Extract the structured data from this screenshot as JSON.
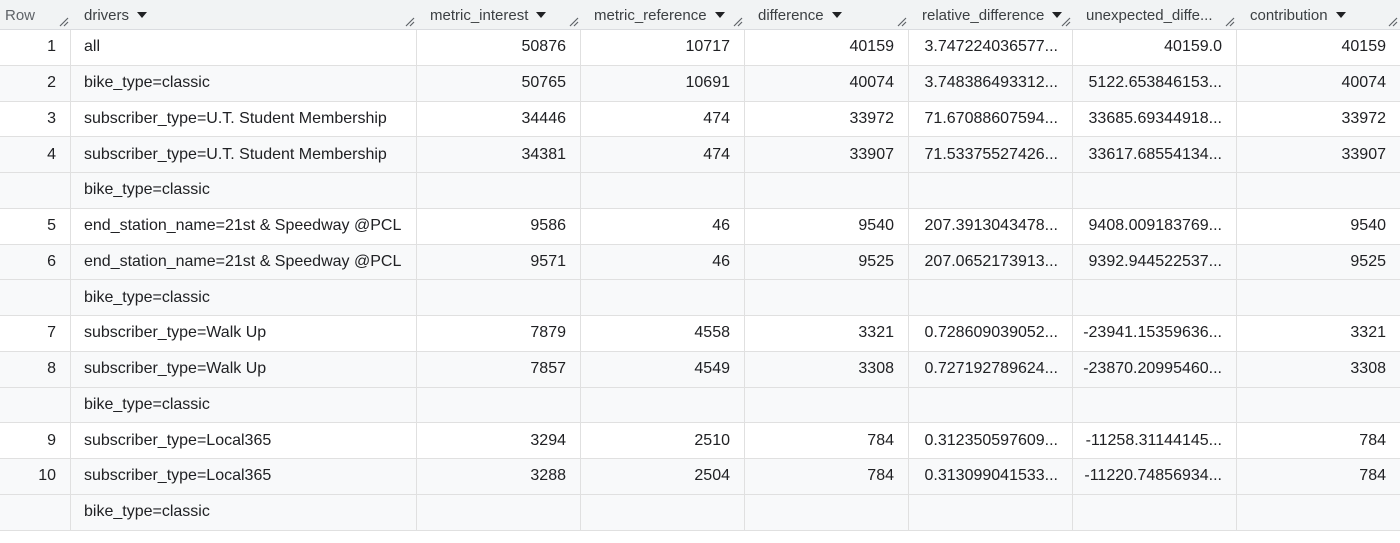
{
  "header": {
    "row_label": "Row",
    "columns": [
      "drivers",
      "metric_interest",
      "metric_reference",
      "difference",
      "relative_difference",
      "unexpected_diffe...",
      "contribution"
    ]
  },
  "rows": [
    {
      "row": "1",
      "drivers": "all",
      "metric_interest": "50876",
      "metric_reference": "10717",
      "difference": "40159",
      "relative_difference": "3.747224036577...",
      "unexpected_difference": "40159.0",
      "contribution": "40159",
      "extra": ""
    },
    {
      "row": "2",
      "drivers": "bike_type=classic",
      "metric_interest": "50765",
      "metric_reference": "10691",
      "difference": "40074",
      "relative_difference": "3.748386493312...",
      "unexpected_difference": "5122.653846153...",
      "contribution": "40074",
      "extra": ""
    },
    {
      "row": "3",
      "drivers": "subscriber_type=U.T. Student Membership",
      "metric_interest": "34446",
      "metric_reference": "474",
      "difference": "33972",
      "relative_difference": "71.67088607594...",
      "unexpected_difference": "33685.69344918...",
      "contribution": "33972",
      "extra": ""
    },
    {
      "row": "4",
      "drivers": "subscriber_type=U.T. Student Membership",
      "metric_interest": "34381",
      "metric_reference": "474",
      "difference": "33907",
      "relative_difference": "71.53375527426...",
      "unexpected_difference": "33617.68554134...",
      "contribution": "33907",
      "extra": "bike_type=classic"
    },
    {
      "row": "5",
      "drivers": "end_station_name=21st & Speedway @PCL",
      "metric_interest": "9586",
      "metric_reference": "46",
      "difference": "9540",
      "relative_difference": "207.3913043478...",
      "unexpected_difference": "9408.009183769...",
      "contribution": "9540",
      "extra": ""
    },
    {
      "row": "6",
      "drivers": "end_station_name=21st & Speedway @PCL",
      "metric_interest": "9571",
      "metric_reference": "46",
      "difference": "9525",
      "relative_difference": "207.0652173913...",
      "unexpected_difference": "9392.944522537...",
      "contribution": "9525",
      "extra": "bike_type=classic"
    },
    {
      "row": "7",
      "drivers": "subscriber_type=Walk Up",
      "metric_interest": "7879",
      "metric_reference": "4558",
      "difference": "3321",
      "relative_difference": "0.728609039052...",
      "unexpected_difference": "-23941.15359636...",
      "contribution": "3321",
      "extra": ""
    },
    {
      "row": "8",
      "drivers": "subscriber_type=Walk Up",
      "metric_interest": "7857",
      "metric_reference": "4549",
      "difference": "3308",
      "relative_difference": "0.727192789624...",
      "unexpected_difference": "-23870.20995460...",
      "contribution": "3308",
      "extra": "bike_type=classic"
    },
    {
      "row": "9",
      "drivers": "subscriber_type=Local365",
      "metric_interest": "3294",
      "metric_reference": "2510",
      "difference": "784",
      "relative_difference": "0.312350597609...",
      "unexpected_difference": "-11258.31144145...",
      "contribution": "784",
      "extra": ""
    },
    {
      "row": "10",
      "drivers": "subscriber_type=Local365",
      "metric_interest": "3288",
      "metric_reference": "2504",
      "difference": "784",
      "relative_difference": "0.313099041533...",
      "unexpected_difference": "-11220.74856934...",
      "contribution": "784",
      "extra": "bike_type=classic"
    }
  ]
}
